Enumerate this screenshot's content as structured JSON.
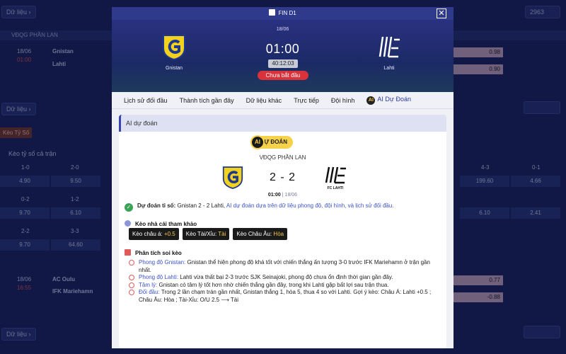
{
  "background": {
    "top_button": "Dữ liệu",
    "right_button_count": "2963",
    "league_label": "VĐQG PHẦN LAN",
    "match1": {
      "date": "18/06",
      "time": "01:00",
      "home": "Gnistan",
      "away": "Lahti",
      "odd1": "0.98",
      "odd2": "0.90"
    },
    "du_lieu_2": "Dữ liệu",
    "keo_tab": "Kèo Tỷ Số",
    "keo_title": "Kèo tỷ số cả trận",
    "grid": {
      "row1_labels": [
        "1-0",
        "2-0",
        "4-3",
        "0-1"
      ],
      "row1_values": [
        "4.90",
        "9.50",
        "199.60",
        "4.66"
      ],
      "row2_labels": [
        "0-2",
        "1-2"
      ],
      "row2_values": [
        "9.70",
        "6.10",
        "6.10",
        "2.41"
      ],
      "row3_labels": [
        "2-2",
        "3-3"
      ],
      "row3_values": [
        "9.70",
        "64.60"
      ]
    },
    "match2": {
      "date": "18/06",
      "time": "16:55",
      "home": "AC Oulu",
      "away": "IFK Mariehamn",
      "odd1": "0.77",
      "odd2": "-0.88"
    },
    "du_lieu_3": "Dữ liệu"
  },
  "modal": {
    "title": "FIN D1",
    "close_icon": "close-icon",
    "date": "18/06",
    "time": "01:00",
    "countdown": "40:12:03",
    "status": "Chưa bắt đầu",
    "home_team": "Gnistan",
    "away_team": "Lahti",
    "tabs": [
      "Lịch sử đối đầu",
      "Thành tích gần đây",
      "Dữ liệu khác",
      "Trực tiếp",
      "Đội hình",
      "AI Dự Đoán"
    ],
    "active_tab": "AI Dự Đoán",
    "ai_badge": "AI",
    "panel": {
      "header": "AI dự đoán",
      "pill": "DỰ ĐOÁN",
      "pill_ai": "AI",
      "league": "VĐQG PHẦN LAN",
      "score": "2 - 2",
      "kick_time": "01:00",
      "kick_sep": " | ",
      "kick_date": "18/06",
      "away_logo_text": "FC LAHTI",
      "prediction_label": "Dự đoán tỉ số:",
      "prediction_value": "Gnistan 2 - 2 Lahti,",
      "prediction_note": "AI dự đoán dựa trên dữ liệu phong độ, đội hình, và lịch sử đối đầu.",
      "odds_title": "Kèo nhà cái tham khảo",
      "chips": [
        {
          "label": "Kèo châu á:",
          "value": "+0.5"
        },
        {
          "label": "Kèo Tài/Xỉu:",
          "value": "Tài"
        },
        {
          "label": "Kèo Châu Âu:",
          "value": "Hòa"
        }
      ],
      "analysis_title": "Phân tích soi kèo",
      "analysis": [
        {
          "key": "Phong độ Gnistan:",
          "text": "Gnistan thể hiện phong độ khá tốt với chiến thắng ấn tượng 3-0 trước IFK Mariehamn ở trận gần nhất."
        },
        {
          "key": "Phong độ Lahti:",
          "text": "Lahti vừa thất bại 2-3 trước SJK Seinajoki, phong độ chưa ổn định thời gian gần đây."
        },
        {
          "key": "Tâm lý:",
          "text": "Gnistan có tâm lý tốt hơn nhờ chiến thắng gần đây, trong khi Lahti gặp bất lợi sau trận thua."
        },
        {
          "key": "Đối đầu:",
          "text": "Trong 2 lần chạm trán gần nhất, Gnistan thắng 1, hòa 5, thua 4 so với Lahti. Gợi ý kèo: Châu Á: Lahti +0.5 ; Châu Âu: Hòa ; Tài-Xỉu: O/U 2.5 ⟶ Tài"
        }
      ]
    }
  },
  "colors": {
    "accent": "#2f3a8c",
    "status": "#d9323a",
    "pill": "#f6d24a",
    "link": "#3a52c8"
  }
}
